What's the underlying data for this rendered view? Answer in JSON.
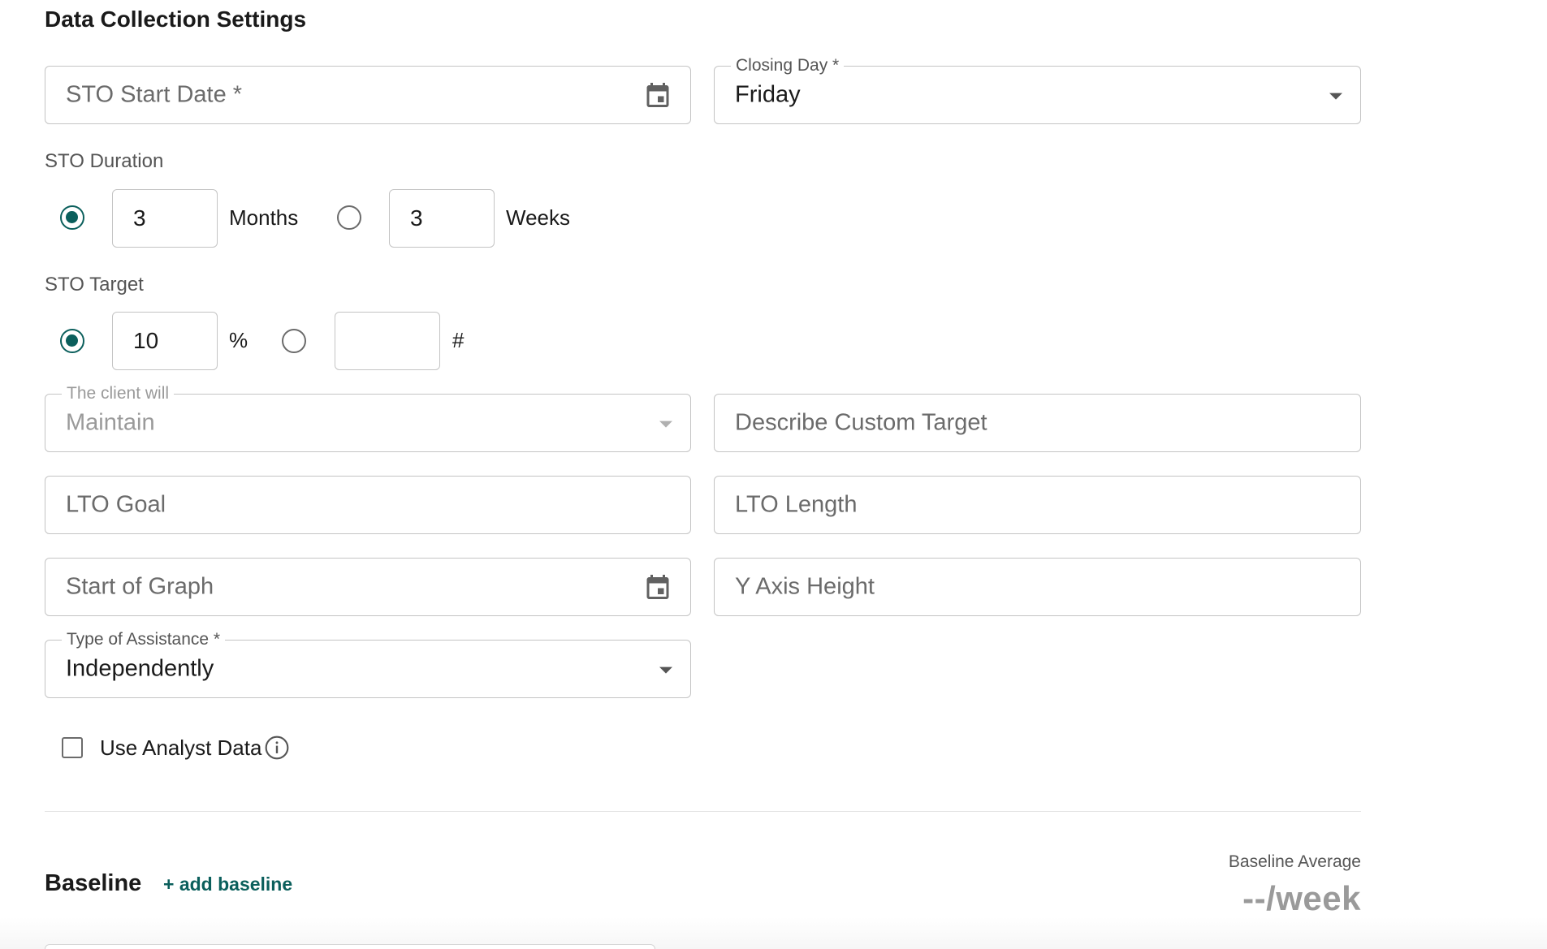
{
  "section_title": "Data Collection Settings",
  "sto_start_date": {
    "placeholder": "STO Start Date *"
  },
  "closing_day": {
    "label": "Closing Day *",
    "value": "Friday"
  },
  "sto_duration": {
    "label": "STO Duration",
    "months_value": "3",
    "months_unit": "Months",
    "weeks_value": "3",
    "weeks_unit": "Weeks",
    "selected": "months"
  },
  "sto_target": {
    "label": "STO Target",
    "percent_value": "10",
    "percent_unit": "%",
    "number_value": "",
    "number_unit": "#",
    "selected": "percent"
  },
  "client_will": {
    "label": "The client will",
    "value": "Maintain"
  },
  "custom_target": {
    "placeholder": "Describe Custom Target"
  },
  "lto_goal": {
    "placeholder": "LTO Goal"
  },
  "lto_length": {
    "placeholder": "LTO Length"
  },
  "start_of_graph": {
    "placeholder": "Start of Graph"
  },
  "y_axis_height": {
    "placeholder": "Y Axis Height"
  },
  "type_of_assistance": {
    "label": "Type of Assistance *",
    "value": "Independently"
  },
  "use_analyst_data": {
    "label": "Use Analyst Data",
    "checked": false
  },
  "baseline": {
    "title": "Baseline",
    "add_label": "+ add baseline",
    "average_label": "Baseline Average",
    "average_value": "--/week"
  },
  "colors": {
    "accent": "#0b5f5c",
    "border": "#c4c4c4",
    "muted": "#9a9a9a"
  },
  "icons": [
    "calendar-icon",
    "dropdown-caret-icon",
    "info-icon"
  ]
}
